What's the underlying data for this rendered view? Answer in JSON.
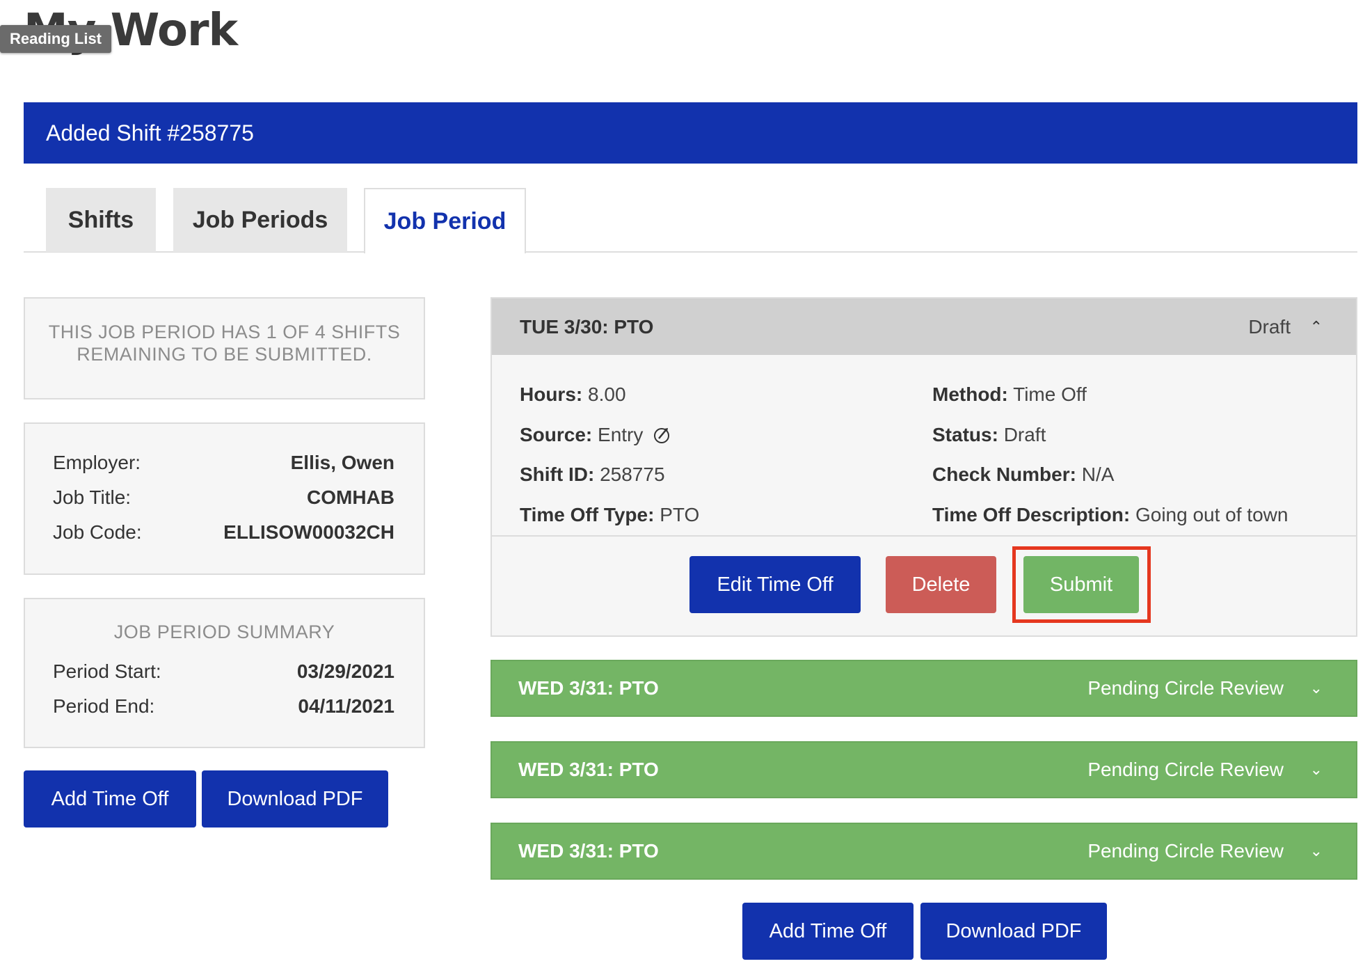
{
  "page": {
    "title": "My Work",
    "reading_list": "Reading List"
  },
  "banner": {
    "text": "Added Shift #258775"
  },
  "tabs": [
    {
      "label": "Shifts",
      "active": false
    },
    {
      "label": "Job Periods",
      "active": false
    },
    {
      "label": "Job Period",
      "active": true
    }
  ],
  "left": {
    "notice": "THIS JOB PERIOD HAS 1 OF 4 SHIFTS REMAINING TO BE SUBMITTED.",
    "info": [
      {
        "label": "Employer:",
        "value": "Ellis, Owen"
      },
      {
        "label": "Job Title:",
        "value": "COMHAB"
      },
      {
        "label": "Job Code:",
        "value": "ELLISOW00032CH"
      }
    ],
    "summary": {
      "title": "JOB PERIOD SUMMARY",
      "rows": [
        {
          "label": "Period Start:",
          "value": "03/29/2021"
        },
        {
          "label": "Period End:",
          "value": "04/11/2021"
        }
      ]
    },
    "buttons": {
      "add_time_off": "Add Time Off",
      "download_pdf": "Download PDF"
    }
  },
  "shift_open": {
    "title": "TUE 3/30: PTO",
    "status": "Draft",
    "fields": {
      "hours_label": "Hours:",
      "hours": "8.00",
      "source_label": "Source:",
      "source": "Entry",
      "shift_id_label": "Shift ID:",
      "shift_id": "258775",
      "time_off_type_label": "Time Off Type:",
      "time_off_type": "PTO",
      "method_label": "Method:",
      "method": "Time Off",
      "status_label": "Status:",
      "status": "Draft",
      "check_number_label": "Check Number:",
      "check_number": "N/A",
      "time_off_desc_label": "Time Off Description:",
      "time_off_desc": "Going out of town"
    },
    "buttons": {
      "edit": "Edit Time Off",
      "delete": "Delete",
      "submit": "Submit"
    }
  },
  "shifts_collapsed": [
    {
      "title": "WED 3/31: PTO",
      "status": "Pending Circle Review"
    },
    {
      "title": "WED 3/31: PTO",
      "status": "Pending Circle Review"
    },
    {
      "title": "WED 3/31: PTO",
      "status": "Pending Circle Review"
    }
  ],
  "bottom_buttons": {
    "add_time_off": "Add Time Off",
    "download_pdf": "Download PDF"
  },
  "colors": {
    "primary": "#1232ad",
    "danger": "#cc5c57",
    "success": "#72b565",
    "highlight": "#e5371f"
  }
}
